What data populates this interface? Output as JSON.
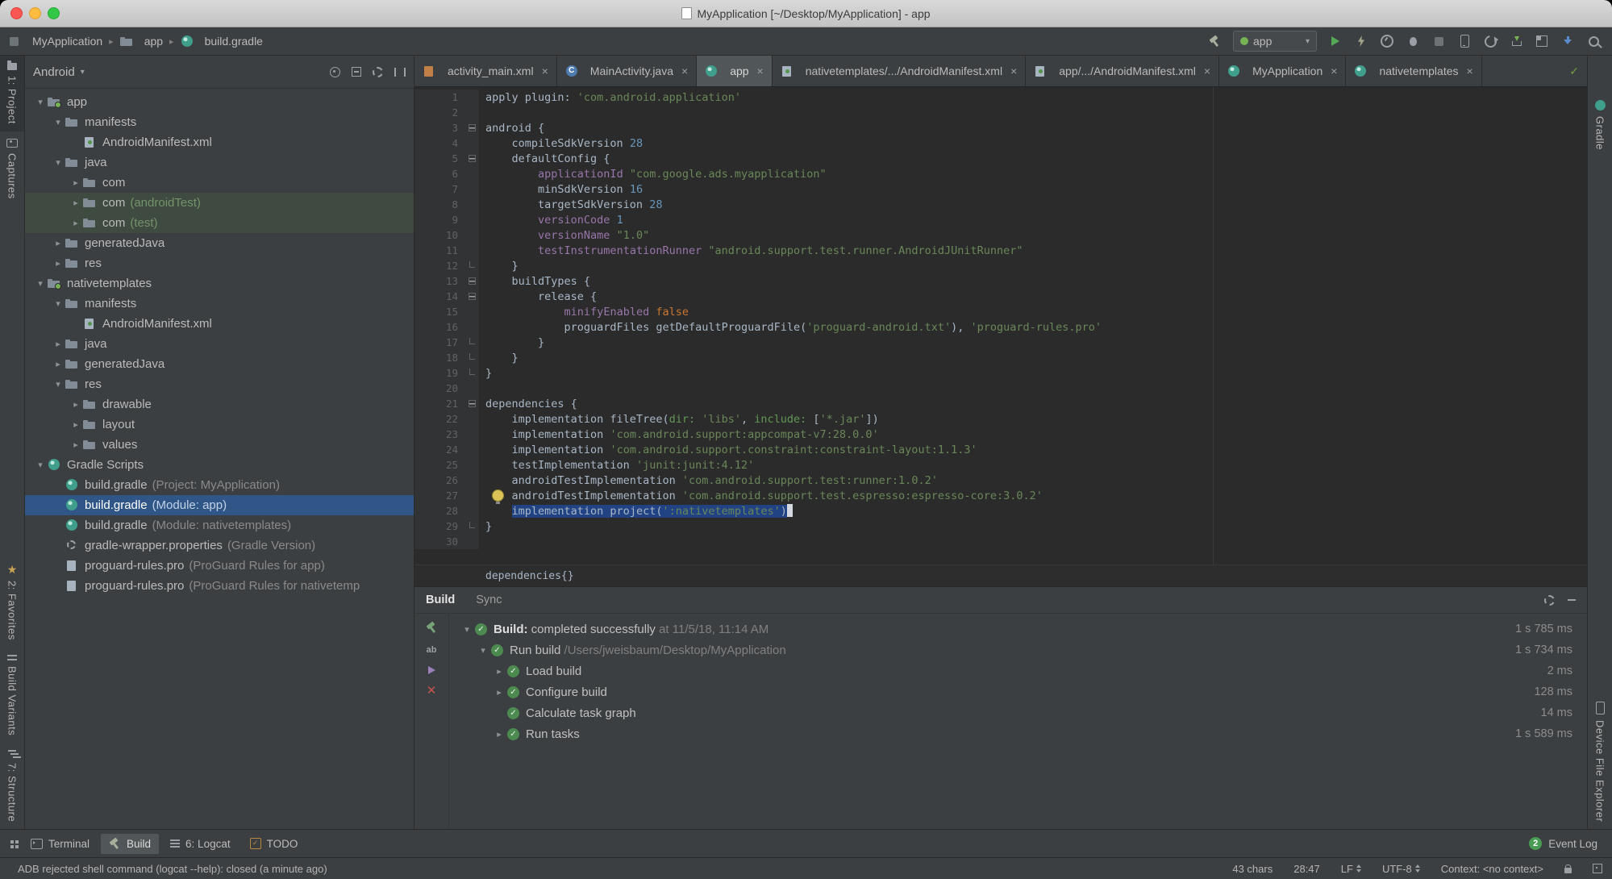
{
  "icons": {
    "chevron_expanded": "▾",
    "chevron_collapsed": "▸",
    "breadcrumb_sep": "▸",
    "combo_caret": "▾",
    "tab_close": "×",
    "check": "✓",
    "star": "★"
  },
  "window": {
    "title": "MyApplication [~/Desktop/MyApplication] - app"
  },
  "main_toolbar": {
    "breadcrumbs": [
      {
        "label": "MyApplication",
        "icon": "project"
      },
      {
        "label": "app",
        "icon": "folder"
      },
      {
        "label": "build.gradle",
        "icon": "gradle"
      }
    ],
    "run_config_label": "app"
  },
  "left_strip": {
    "top": [
      {
        "label": "1: Project",
        "icon": "project-tool",
        "active": true
      },
      {
        "label": "Captures",
        "icon": "captures-tool"
      }
    ],
    "bottom": [
      {
        "label": "2: Favorites",
        "icon": "favorites-tool"
      },
      {
        "label": "Build Variants",
        "icon": "build-variants-tool"
      },
      {
        "label": "7: Structure",
        "icon": "structure-tool"
      }
    ]
  },
  "right_strip": {
    "top": [
      {
        "label": "Gradle",
        "icon": "gradle-tool"
      }
    ],
    "bottom": [
      {
        "label": "Device File Explorer",
        "icon": "device-tool"
      }
    ]
  },
  "project_panel": {
    "view_selector": "Android",
    "tree": [
      {
        "label": "app",
        "icon": "module",
        "indent": 0,
        "state": "expanded"
      },
      {
        "label": "manifests",
        "icon": "folder",
        "indent": 1,
        "state": "expanded"
      },
      {
        "label": "AndroidManifest.xml",
        "icon": "manifest",
        "indent": 2,
        "state": "none"
      },
      {
        "label": "java",
        "icon": "folder",
        "indent": 1,
        "state": "expanded"
      },
      {
        "label": "com",
        "icon": "package",
        "indent": 2,
        "state": "collapsed"
      },
      {
        "label": "com",
        "suffix": "(androidTest)",
        "suffix_green": true,
        "icon": "package",
        "indent": 2,
        "state": "collapsed",
        "tinted": true
      },
      {
        "label": "com",
        "suffix": "(test)",
        "suffix_green": true,
        "icon": "package",
        "indent": 2,
        "state": "collapsed",
        "tinted": true
      },
      {
        "label": "generatedJava",
        "icon": "folder",
        "indent": 1,
        "state": "collapsed"
      },
      {
        "label": "res",
        "icon": "folder",
        "indent": 1,
        "state": "collapsed"
      },
      {
        "label": "nativetemplates",
        "icon": "module",
        "indent": 0,
        "state": "expanded"
      },
      {
        "label": "manifests",
        "icon": "folder",
        "indent": 1,
        "state": "expanded"
      },
      {
        "label": "AndroidManifest.xml",
        "icon": "manifest",
        "indent": 2,
        "state": "none"
      },
      {
        "label": "java",
        "icon": "folder",
        "indent": 1,
        "state": "collapsed"
      },
      {
        "label": "generatedJava",
        "icon": "folder",
        "indent": 1,
        "state": "collapsed"
      },
      {
        "label": "res",
        "icon": "folder",
        "indent": 1,
        "state": "expanded"
      },
      {
        "label": "drawable",
        "icon": "folder",
        "indent": 2,
        "state": "collapsed"
      },
      {
        "label": "layout",
        "icon": "folder",
        "indent": 2,
        "state": "collapsed"
      },
      {
        "label": "values",
        "icon": "folder",
        "indent": 2,
        "state": "collapsed"
      },
      {
        "label": "Gradle Scripts",
        "icon": "gradle",
        "indent": 0,
        "state": "expanded"
      },
      {
        "label": "build.gradle",
        "suffix": "(Project: MyApplication)",
        "icon": "gradle",
        "indent": 1,
        "state": "none"
      },
      {
        "label": "build.gradle",
        "suffix": "(Module: app)",
        "icon": "gradle",
        "indent": 1,
        "state": "none",
        "selected": true
      },
      {
        "label": "build.gradle",
        "suffix": "(Module: nativetemplates)",
        "icon": "gradle",
        "indent": 1,
        "state": "none"
      },
      {
        "label": "gradle-wrapper.properties",
        "suffix": "(Gradle Version)",
        "icon": "wrapper",
        "indent": 1,
        "state": "none"
      },
      {
        "label": "proguard-rules.pro",
        "suffix": "(ProGuard Rules for app)",
        "icon": "pro",
        "indent": 1,
        "state": "none"
      },
      {
        "label": "proguard-rules.pro",
        "suffix": "(ProGuard Rules for nativetemp",
        "icon": "pro",
        "indent": 1,
        "state": "none"
      }
    ]
  },
  "editor": {
    "tabs": [
      {
        "label": "activity_main.xml",
        "icon": "xml"
      },
      {
        "label": "MainActivity.java",
        "icon": "class"
      },
      {
        "label": "app",
        "icon": "gradle",
        "active": true
      },
      {
        "label": "nativetemplates/.../AndroidManifest.xml",
        "icon": "manifest"
      },
      {
        "label": "app/.../AndroidManifest.xml",
        "icon": "manifest"
      },
      {
        "label": "MyApplication",
        "icon": "gradle"
      },
      {
        "label": "nativetemplates",
        "icon": "gradle"
      }
    ],
    "breadcrumb": "dependencies{}",
    "code": [
      {
        "n": 1,
        "segs": [
          [
            "apply plugin: ",
            "pl"
          ],
          [
            "'com.android.application'",
            "str"
          ]
        ]
      },
      {
        "n": 2,
        "segs": []
      },
      {
        "n": 3,
        "fold": "start",
        "segs": [
          [
            "android {",
            "pl"
          ]
        ]
      },
      {
        "n": 4,
        "segs": [
          [
            "    compileSdkVersion ",
            "pl"
          ],
          [
            "28",
            "num"
          ]
        ]
      },
      {
        "n": 5,
        "fold": "start",
        "segs": [
          [
            "    defaultConfig {",
            "pl"
          ]
        ]
      },
      {
        "n": 6,
        "segs": [
          [
            "        ",
            "pl"
          ],
          [
            "applicationId",
            "prop"
          ],
          [
            " ",
            "pl"
          ],
          [
            "\"com.google.ads.myapplication\"",
            "str"
          ]
        ]
      },
      {
        "n": 7,
        "segs": [
          [
            "        minSdkVersion ",
            "pl"
          ],
          [
            "16",
            "num"
          ]
        ]
      },
      {
        "n": 8,
        "segs": [
          [
            "        targetSdkVersion ",
            "pl"
          ],
          [
            "28",
            "num"
          ]
        ]
      },
      {
        "n": 9,
        "segs": [
          [
            "        ",
            "pl"
          ],
          [
            "versionCode",
            "prop"
          ],
          [
            " ",
            "pl"
          ],
          [
            "1",
            "num"
          ]
        ]
      },
      {
        "n": 10,
        "segs": [
          [
            "        ",
            "pl"
          ],
          [
            "versionName",
            "prop"
          ],
          [
            " ",
            "pl"
          ],
          [
            "\"1.0\"",
            "str"
          ]
        ]
      },
      {
        "n": 11,
        "segs": [
          [
            "        ",
            "pl"
          ],
          [
            "testInstrumentationRunner",
            "prop"
          ],
          [
            " ",
            "pl"
          ],
          [
            "\"android.support.test.runner.AndroidJUnitRunner\"",
            "str"
          ]
        ]
      },
      {
        "n": 12,
        "fold": "end",
        "segs": [
          [
            "    }",
            "pl"
          ]
        ]
      },
      {
        "n": 13,
        "fold": "start",
        "segs": [
          [
            "    buildTypes {",
            "pl"
          ]
        ]
      },
      {
        "n": 14,
        "fold": "start",
        "segs": [
          [
            "        release {",
            "pl"
          ]
        ]
      },
      {
        "n": 15,
        "segs": [
          [
            "            ",
            "pl"
          ],
          [
            "minifyEnabled",
            "prop"
          ],
          [
            " ",
            "pl"
          ],
          [
            "false",
            "kw"
          ]
        ]
      },
      {
        "n": 16,
        "segs": [
          [
            "            proguardFiles getDefaultProguardFile(",
            "pl"
          ],
          [
            "'proguard-android.txt'",
            "str"
          ],
          [
            "), ",
            "pl"
          ],
          [
            "'proguard-rules.pro'",
            "str"
          ]
        ]
      },
      {
        "n": 17,
        "fold": "end",
        "segs": [
          [
            "        }",
            "pl"
          ]
        ]
      },
      {
        "n": 18,
        "fold": "end",
        "segs": [
          [
            "    }",
            "pl"
          ]
        ]
      },
      {
        "n": 19,
        "fold": "end",
        "segs": [
          [
            "}",
            "pl"
          ]
        ]
      },
      {
        "n": 20,
        "segs": []
      },
      {
        "n": 21,
        "fold": "start",
        "segs": [
          [
            "dependencies {",
            "pl"
          ]
        ]
      },
      {
        "n": 22,
        "segs": [
          [
            "    implementation fileTree(",
            "pl"
          ],
          [
            "dir: ",
            "arg"
          ],
          [
            "'libs'",
            "str"
          ],
          [
            ", ",
            "pl"
          ],
          [
            "include: ",
            "arg"
          ],
          [
            "[",
            "pl"
          ],
          [
            "'*.jar'",
            "str"
          ],
          [
            "])",
            "pl"
          ]
        ]
      },
      {
        "n": 23,
        "segs": [
          [
            "    implementation ",
            "pl"
          ],
          [
            "'com.android.support:appcompat-v7:28.0.0'",
            "str"
          ]
        ]
      },
      {
        "n": 24,
        "segs": [
          [
            "    implementation ",
            "pl"
          ],
          [
            "'com.android.support.constraint:constraint-layout:1.1.3'",
            "str"
          ]
        ]
      },
      {
        "n": 25,
        "segs": [
          [
            "    testImplementation ",
            "pl"
          ],
          [
            "'junit:junit:4.12'",
            "str"
          ]
        ]
      },
      {
        "n": 26,
        "segs": [
          [
            "    androidTestImplementation ",
            "pl"
          ],
          [
            "'com.android.support.test:runner:1.0.2'",
            "str"
          ]
        ]
      },
      {
        "n": 27,
        "bulb": true,
        "segs": [
          [
            "    androidTestImplementation ",
            "pl"
          ],
          [
            "'com.android.support.test.espresso:espresso-core:3.0.2'",
            "str"
          ]
        ]
      },
      {
        "n": 28,
        "caret": true,
        "segs": [
          [
            "    ",
            "pl"
          ],
          [
            "implementation project(",
            "pl",
            1
          ],
          [
            "':nativetemplates'",
            "str",
            1
          ],
          [
            ")",
            "pl",
            1
          ]
        ]
      },
      {
        "n": 29,
        "fold": "end",
        "segs": [
          [
            "}",
            "pl"
          ]
        ]
      },
      {
        "n": 30,
        "segs": []
      }
    ]
  },
  "build_panel": {
    "tabs": [
      {
        "label": "Build",
        "active": true
      },
      {
        "label": "Sync"
      }
    ],
    "rows": [
      {
        "indent": 0,
        "chevron": "expanded",
        "segments": [
          [
            "Build:",
            "b"
          ],
          [
            " completed successfully",
            "t"
          ],
          [
            "  at 11/5/18, 11:14 AM",
            "d"
          ]
        ],
        "time": "1 s 785 ms"
      },
      {
        "indent": 1,
        "chevron": "expanded",
        "segments": [
          [
            "Run build",
            "t"
          ],
          [
            "  /Users/jweisbaum/Desktop/MyApplication",
            "d"
          ]
        ],
        "time": "1 s 734 ms"
      },
      {
        "indent": 2,
        "chevron": "collapsed",
        "segments": [
          [
            "Load build",
            "t"
          ]
        ],
        "time": "2 ms"
      },
      {
        "indent": 2,
        "chevron": "collapsed",
        "segments": [
          [
            "Configure build",
            "t"
          ]
        ],
        "time": "128 ms"
      },
      {
        "indent": 2,
        "chevron": "none",
        "segments": [
          [
            "Calculate task graph",
            "t"
          ]
        ],
        "time": "14 ms"
      },
      {
        "indent": 2,
        "chevron": "collapsed",
        "segments": [
          [
            "Run tasks",
            "t"
          ]
        ],
        "time": "1 s 589 ms"
      }
    ]
  },
  "bottom_bar": {
    "items": [
      {
        "label": "Terminal",
        "icon": "terminal"
      },
      {
        "label": "Build",
        "icon": "hammer",
        "active": true
      },
      {
        "label": "6: Logcat",
        "icon": "logcat"
      },
      {
        "label": "TODO",
        "icon": "todo"
      }
    ],
    "event_log_label": "Event Log",
    "event_count": "2"
  },
  "status_bar": {
    "message": "ADB rejected shell command (logcat --help): closed (a minute ago)",
    "selection_info": "43 chars",
    "caret_position": "28:47",
    "line_separator": "LF",
    "encoding": "UTF-8",
    "context": "Context: <no context>"
  }
}
